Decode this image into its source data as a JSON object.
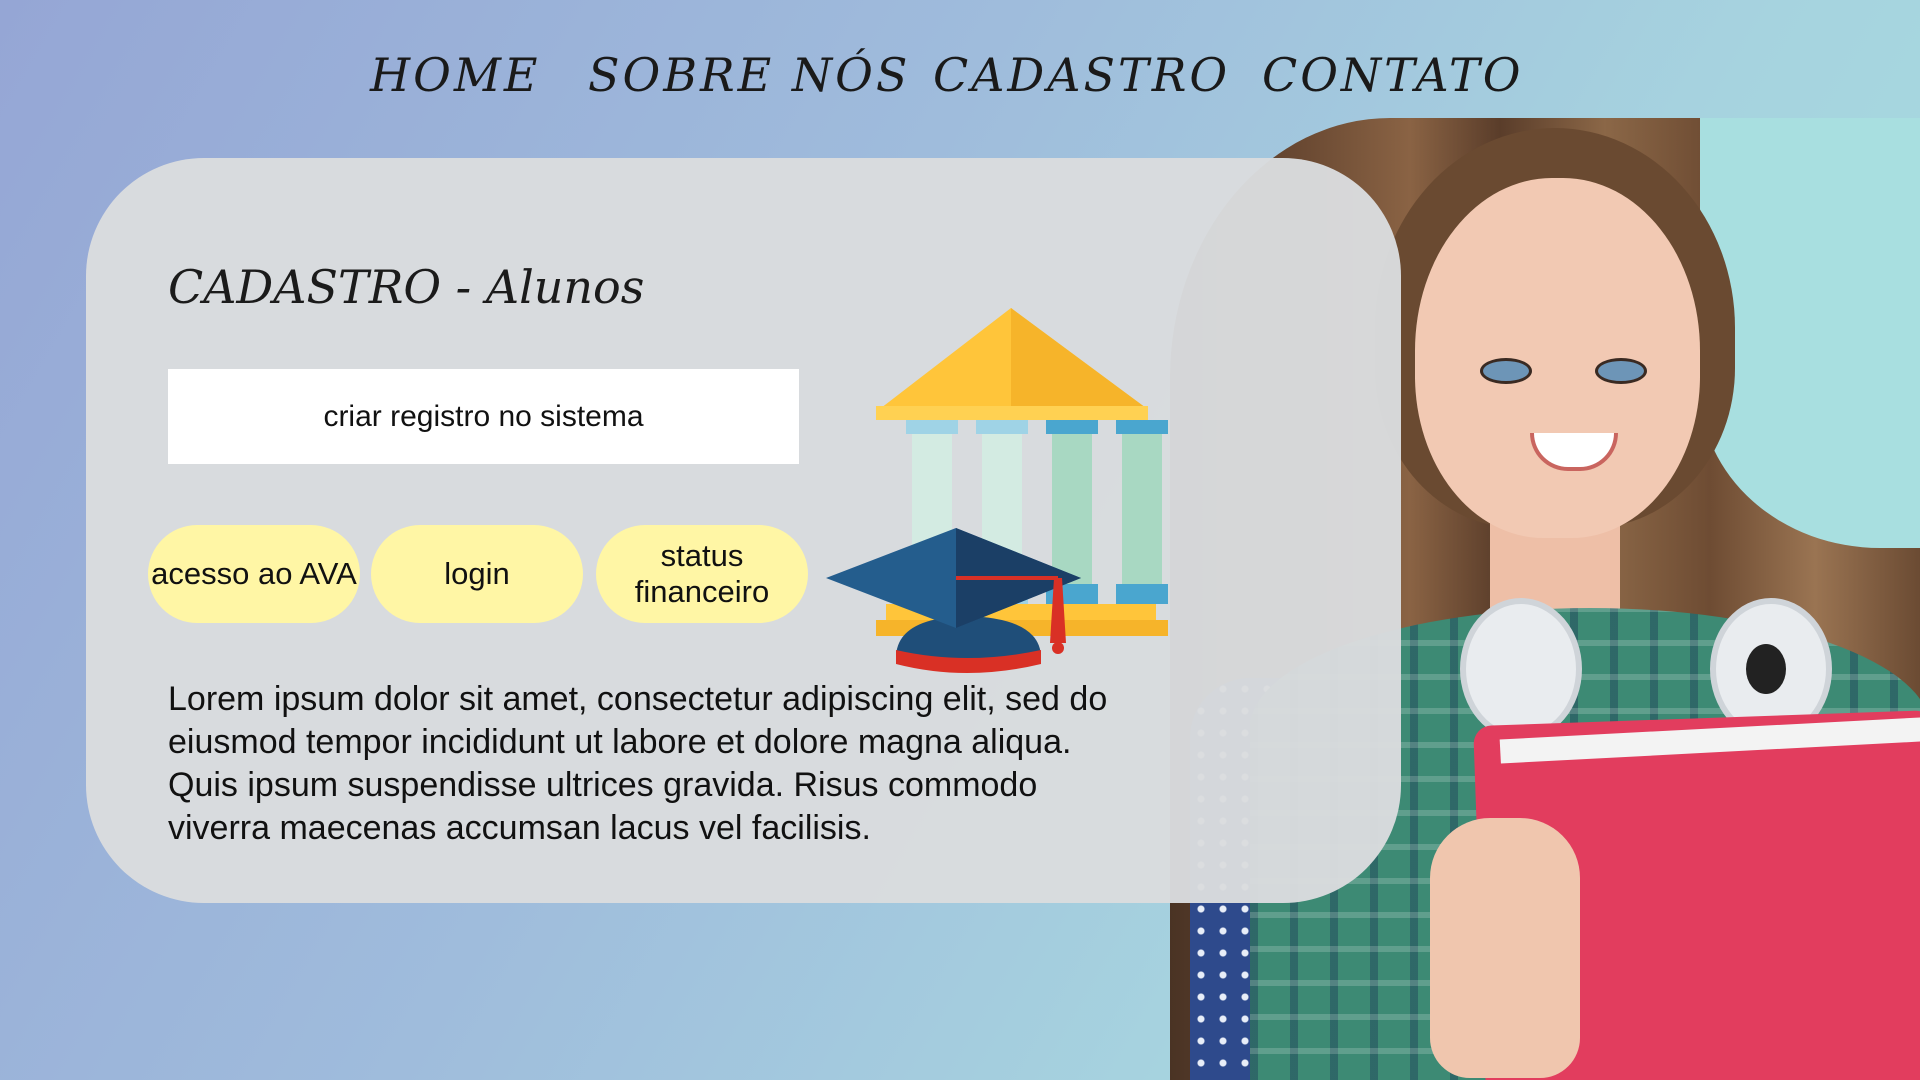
{
  "nav": {
    "items": [
      {
        "label": "HOME"
      },
      {
        "label": "SOBRE NÓS"
      },
      {
        "label": "CADASTRO"
      },
      {
        "label": "CONTATO"
      }
    ]
  },
  "card": {
    "title": "CADASTRO - Alunos",
    "primary_button": "criar registro no sistema",
    "buttons": [
      {
        "label": "acesso ao AVA"
      },
      {
        "label": "login"
      },
      {
        "label": "status financeiro"
      }
    ],
    "description": "Lorem ipsum dolor sit amet, consectetur adipiscing elit, sed do eiusmod tempor incididunt ut labore et dolore magna aliqua. Quis ipsum suspendisse ultrices gravida. Risus commodo viverra maecenas accumsan lacus vel facilisis."
  },
  "illustration": {
    "icons": [
      "university-building-icon",
      "graduation-cap-icon"
    ]
  },
  "photo": {
    "subject": "student-photo"
  },
  "colors": {
    "pill_bg": "#fff6a5",
    "card_bg": "#dadcde",
    "roof": "#ffc53a",
    "cap": "#1f4e79",
    "accent_red": "#d93025"
  }
}
